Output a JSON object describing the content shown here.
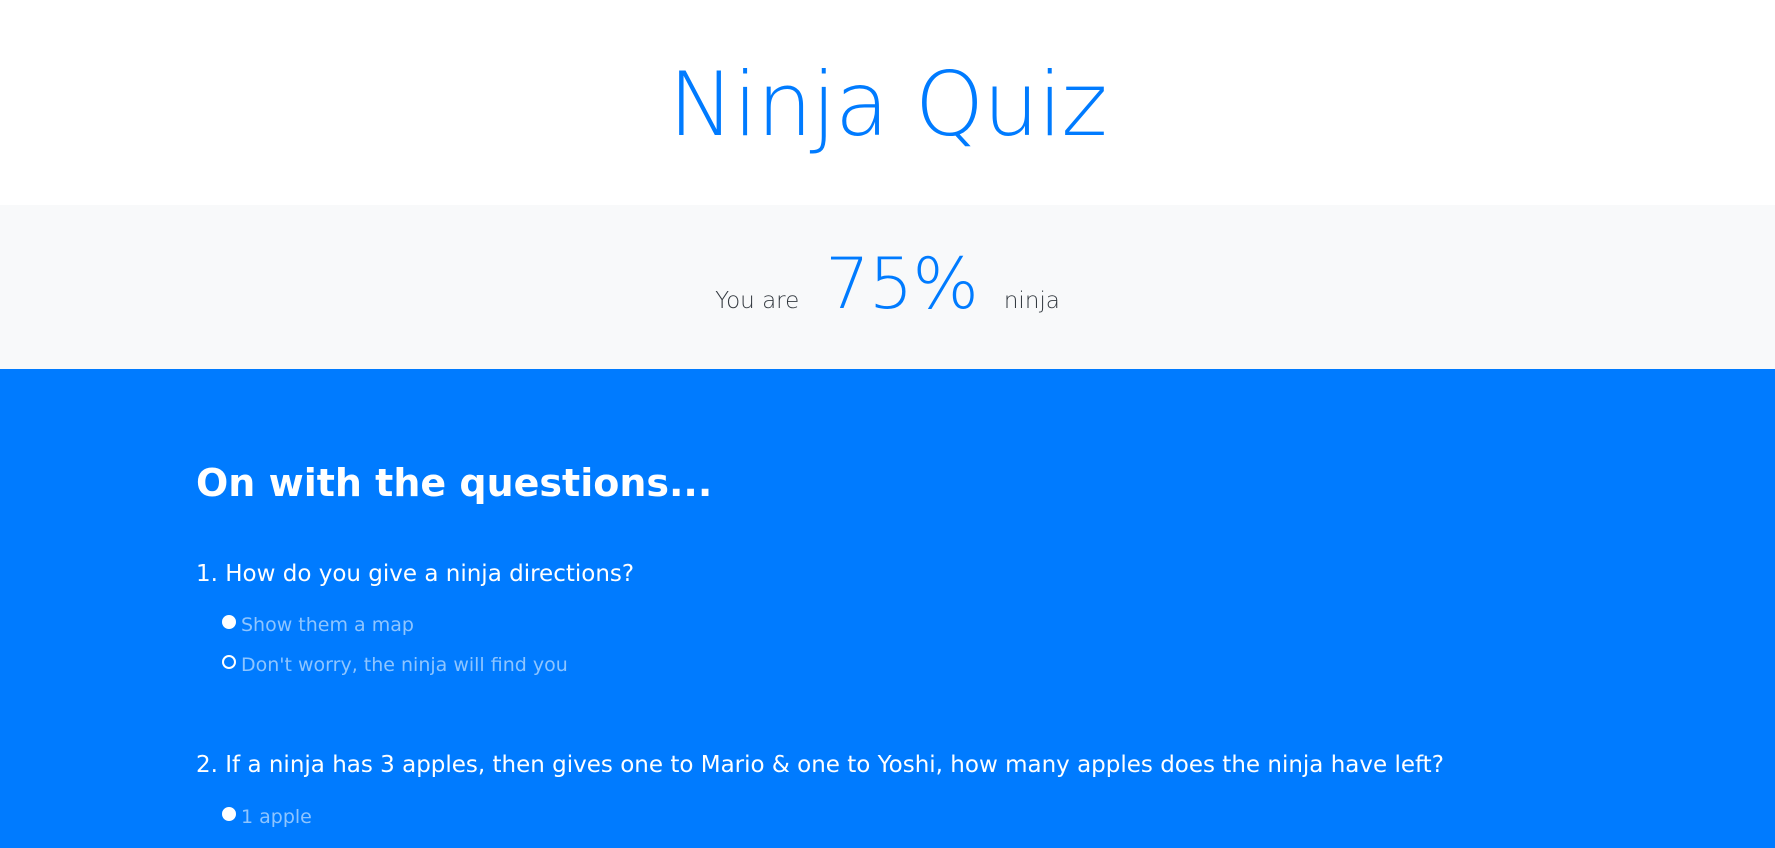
{
  "header": {
    "title": "Ninja Quiz"
  },
  "result": {
    "prefix": "You are",
    "score": "75%",
    "suffix": "ninja"
  },
  "questions_section": {
    "heading": "On with the questions...",
    "questions": [
      {
        "text": "1. How do you give a ninja directions?",
        "answers": [
          {
            "label": "Show them a map"
          },
          {
            "label": "Don't worry, the ninja will find you"
          }
        ]
      },
      {
        "text": "2. If a ninja has 3 apples, then gives one to Mario & one to Yoshi, how many apples does the ninja have left?",
        "answers": [
          {
            "label": "1 apple"
          }
        ]
      }
    ]
  },
  "colors": {
    "brand_blue": "#007bff",
    "band_gray": "#f8f9fa",
    "answer_text": "#8ec5ff"
  }
}
